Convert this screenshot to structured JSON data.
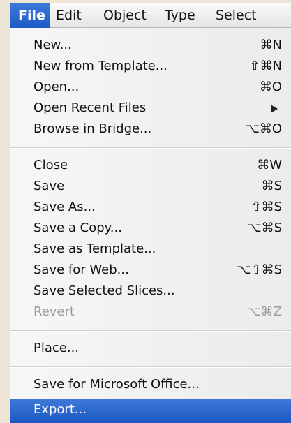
{
  "menubar": {
    "items": [
      "File",
      "Edit",
      "Object",
      "Type",
      "Select"
    ]
  },
  "menu": {
    "new": {
      "label": "New...",
      "shortcut": "⌘N"
    },
    "new_from_template": {
      "label": "New from Template...",
      "shortcut": "⇧⌘N"
    },
    "open": {
      "label": "Open...",
      "shortcut": "⌘O"
    },
    "open_recent_files": {
      "label": "Open Recent Files",
      "submenu_icon": "submenu-arrow"
    },
    "browse_in_bridge": {
      "label": "Browse in Bridge...",
      "shortcut": "⌥⌘O"
    },
    "close": {
      "label": "Close",
      "shortcut": "⌘W"
    },
    "save": {
      "label": "Save",
      "shortcut": "⌘S"
    },
    "save_as": {
      "label": "Save As...",
      "shortcut": "⇧⌘S"
    },
    "save_a_copy": {
      "label": "Save a Copy...",
      "shortcut": "⌥⌘S"
    },
    "save_as_template": {
      "label": "Save as Template..."
    },
    "save_for_web": {
      "label": "Save for Web...",
      "shortcut": "⌥⇧⌘S"
    },
    "save_selected_slices": {
      "label": "Save Selected Slices..."
    },
    "revert": {
      "label": "Revert",
      "shortcut": "⌥⌘Z"
    },
    "place": {
      "label": "Place..."
    },
    "save_for_microsoft_office": {
      "label": "Save for Microsoft Office..."
    },
    "export": {
      "label": "Export..."
    }
  },
  "colors": {
    "highlight": "#2f6bd2",
    "background": "#ede6d7",
    "menu_background": "#f3f3f3",
    "disabled_text": "#9b9b9b"
  }
}
